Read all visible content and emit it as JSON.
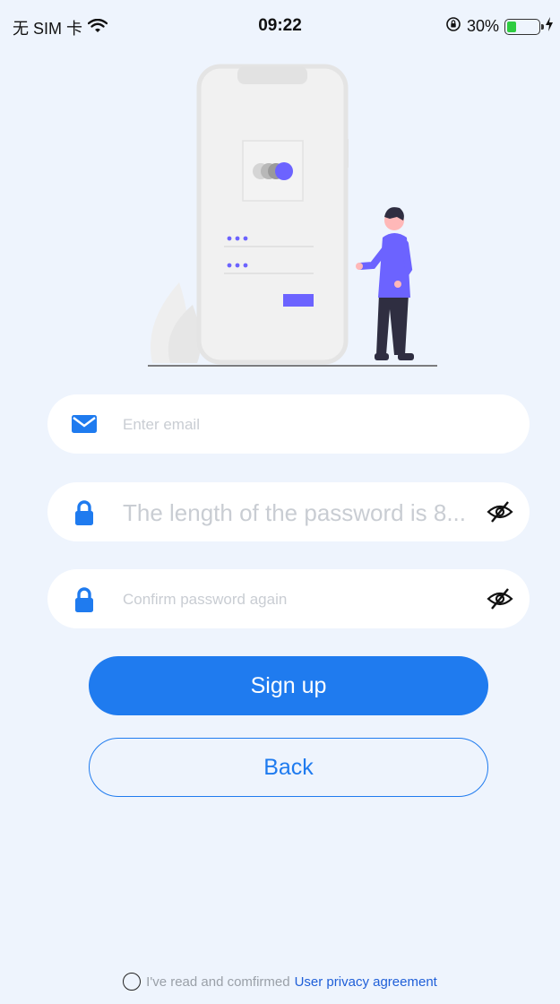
{
  "status_bar": {
    "carrier": "无 SIM 卡",
    "time": "09:22",
    "battery_percent": "30%",
    "battery_level": 0.3
  },
  "form": {
    "email_placeholder": "Enter email",
    "password_placeholder": "The length of the password is 8...",
    "confirm_placeholder": "Confirm password again"
  },
  "buttons": {
    "sign_up": "Sign up",
    "back": "Back"
  },
  "agreement": {
    "text": "I've read and comfirmed",
    "link": "User privacy agreement"
  },
  "colors": {
    "accent": "#1f7bef",
    "background": "#eef4fd",
    "illustration_accent": "#6c63ff"
  },
  "icons": [
    "wifi-icon",
    "rotation-lock-icon",
    "battery-icon",
    "charging-icon",
    "mail-icon",
    "lock-icon",
    "eye-slash-icon"
  ]
}
